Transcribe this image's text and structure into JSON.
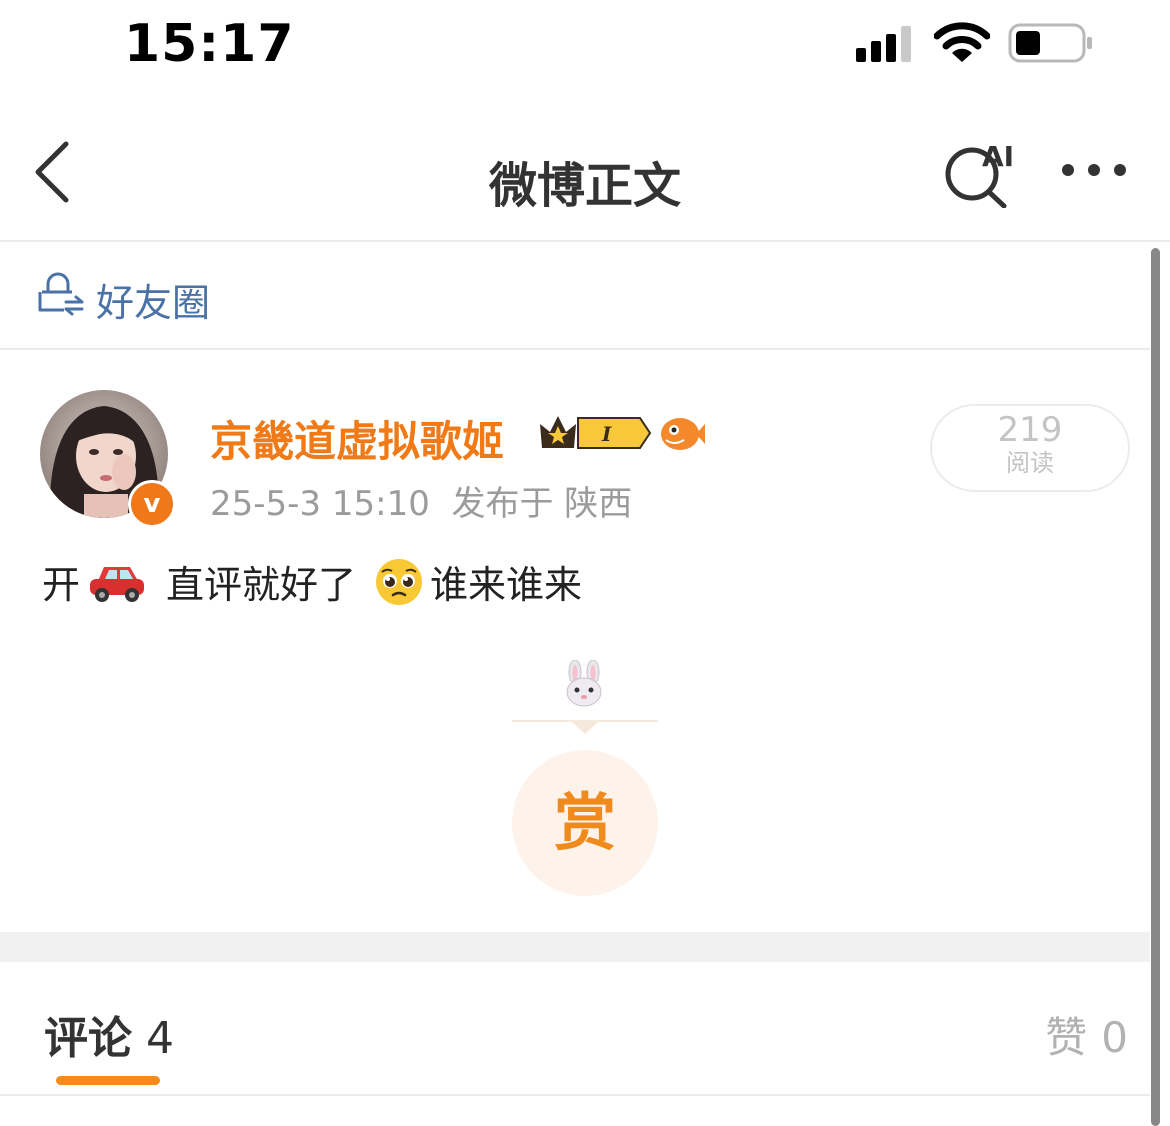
{
  "status_bar": {
    "time": "15:17"
  },
  "nav": {
    "title": "微博正文",
    "ai_label": "AI"
  },
  "friend_circle": {
    "label": "好友圈"
  },
  "post": {
    "author": "京畿道虚拟歌姬",
    "verified_mark": "v",
    "level_badge": "I",
    "meta": "25-5-3 15:10  发布于 陕西",
    "reads": {
      "count": "219",
      "label": "阅读"
    },
    "text_parts": [
      "开",
      "直评就好了",
      "谁来谁来"
    ],
    "reward_label": "赏"
  },
  "tabs": {
    "comments_label": "评论",
    "comments_count": "4",
    "likes_label": "赞",
    "likes_count": "0"
  },
  "colors": {
    "accent_orange": "#ef7a17",
    "link_blue": "#4a72a6",
    "meta_gray": "#9b9b9b"
  }
}
